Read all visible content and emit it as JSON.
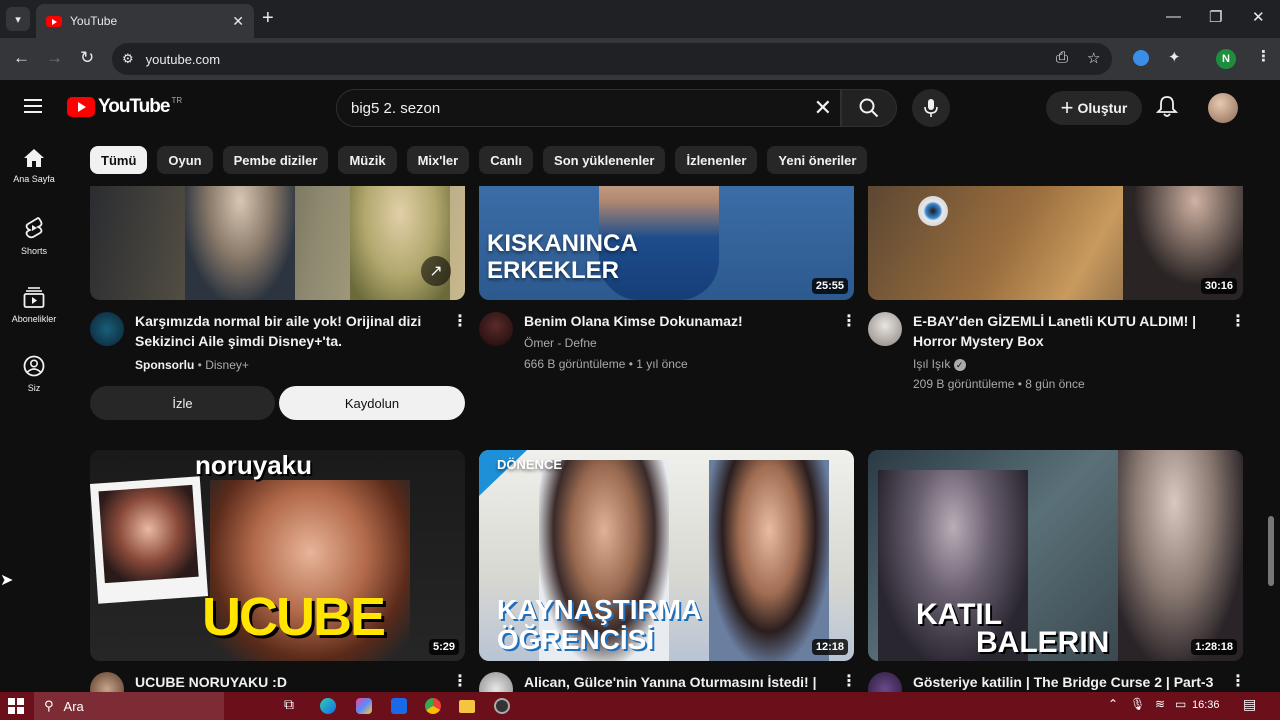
{
  "browser": {
    "tab_title": "YouTube",
    "url": "youtube.com",
    "profile_initial": "N"
  },
  "header": {
    "logo_text": "YouTube",
    "logo_region": "TR",
    "search_value": "big5 2. sezon",
    "create_label": "Oluştur"
  },
  "sidebar": {
    "items": [
      {
        "label": "Ana Sayfa",
        "icon": "home-icon"
      },
      {
        "label": "Shorts",
        "icon": "shorts-icon"
      },
      {
        "label": "Abonelikler",
        "icon": "subscriptions-icon"
      },
      {
        "label": "Siz",
        "icon": "you-icon"
      }
    ]
  },
  "chips": [
    "Tümü",
    "Oyun",
    "Pembe diziler",
    "Müzik",
    "Mix'ler",
    "Canlı",
    "Son yüklenenler",
    "İzlenenler",
    "Yeni öneriler"
  ],
  "videos_row1": [
    {
      "title_l1": "Karşımızda normal bir aile yok! Orijinal dizi",
      "title_l2": "Sekizinci Aile şimdi Disney+'ta.",
      "sponsored": "Sponsorlu",
      "channel": "Disney+",
      "watch_label": "İzle",
      "subscribe_label": "Kaydolun"
    },
    {
      "title_l1": "Benim Olana Kimse Dokunamaz!",
      "channel": "Ömer - Defne",
      "meta": "666 B görüntüleme • 1 yıl önce",
      "duration": "25:55",
      "thumb_l1": "KISKANINCA",
      "thumb_l2": "ERKEKLER"
    },
    {
      "title_l1": "E-BAY'den GİZEMLİ Lanetli KUTU ALDIM! |",
      "title_l2": "Horror Mystery Box",
      "channel": "Işıl Işık",
      "meta": "209 B görüntüleme • 8 gün önce",
      "duration": "30:16"
    }
  ],
  "videos_row2": [
    {
      "title_l1": "UCUBE NORUYAKU :D",
      "duration": "5:29",
      "thumb_top": "noruyaku",
      "thumb_bottom": "UCUBE"
    },
    {
      "title_l1": "Alican, Gülce'nin Yanına Oturmasını İstedi! |",
      "duration": "12:18",
      "thumb_top": "DÖNENCE",
      "thumb_l1": "KAYNAŞTIRMA",
      "thumb_l2": "ÖĞRENCİSİ"
    },
    {
      "title_l1": "Gösteriye katilin | The Bridge Curse 2 | Part-3",
      "duration": "1:28:18",
      "thumb_l1": "KATIL",
      "thumb_l2": "BALERIN"
    }
  ],
  "taskbar": {
    "search_label": "Ara",
    "time": "16:36"
  }
}
